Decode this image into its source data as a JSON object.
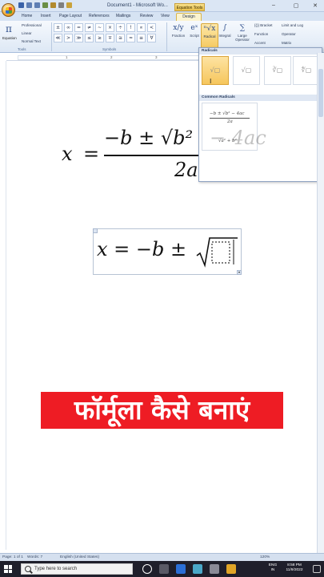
{
  "window": {
    "doc_title": "Document1 - Microsoft Wo...",
    "context_tab": "Equation Tools",
    "minimize": "–",
    "maximize": "▢",
    "close": "✕"
  },
  "tabs": [
    "Home",
    "Insert",
    "Page Layout",
    "References",
    "Mailings",
    "Review",
    "View",
    "Design"
  ],
  "ribbon": {
    "equation_label": "Equation",
    "tools": [
      "Professional",
      "Linear",
      "Normal Text"
    ],
    "tools_group": "Tools",
    "symbols_group": "Symbols",
    "symbols": [
      "±",
      "∞",
      "=",
      "≠",
      "~",
      "×",
      "÷",
      "!",
      "∝",
      "<",
      "≪",
      ">",
      "≫",
      "≤",
      "≥",
      "∓",
      "≅",
      "≈",
      "≡",
      "∀"
    ],
    "structures": [
      {
        "glyph": "x/y",
        "label": "Fraction"
      },
      {
        "glyph": "eˣ",
        "label": "Script"
      },
      {
        "glyph": "ⁿ√x",
        "label": "Radical"
      },
      {
        "glyph": "∫",
        "label": "Integral"
      },
      {
        "glyph": "∑",
        "label": "Large Operator"
      }
    ],
    "right": [
      "{()} Bracket",
      "Limit and Log",
      "Function",
      "Operator",
      "Accent",
      "Matrix"
    ]
  },
  "ruler": {
    "marks": [
      "1",
      "2",
      "3"
    ]
  },
  "document": {
    "formula1": {
      "x": "x",
      "eq": "=",
      "numerator": "−b ± √b²",
      "denominator": "2a"
    },
    "formula2": "x = −b ± ",
    "banner": "फॉर्मूला कैसे बनाएं"
  },
  "radical_menu": {
    "header": "Radicals",
    "options": [
      "√▢",
      "√▢",
      "∛▢",
      "∜▢"
    ],
    "common_header": "Common Radicals",
    "common1_num": "−b ± √b² − 4ac",
    "common1_den": "2a",
    "common2": "√a² + b²",
    "ghost_text": "− 4ac"
  },
  "status": {
    "page": "Page: 1 of 1",
    "words": "Words: 7",
    "lang": "English (United States)",
    "zoom": "120%"
  },
  "taskbar": {
    "search_placeholder": "Type here to search",
    "lang": "ENG",
    "region": "IN",
    "time": "8:58 PM",
    "date": "11/9/2022"
  }
}
